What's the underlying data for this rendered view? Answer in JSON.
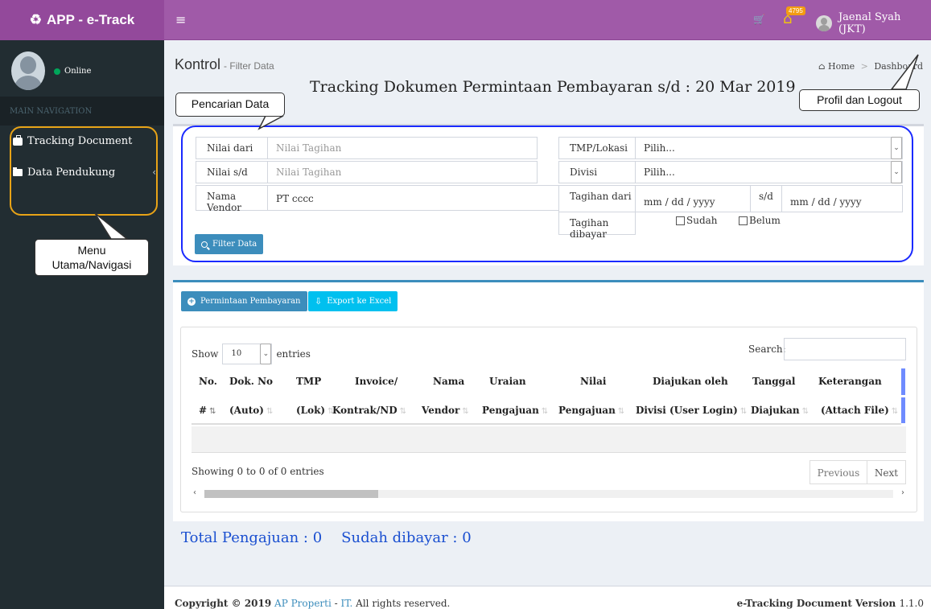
{
  "brand": {
    "title": "APP - e-Track",
    "icon": "recycle-icon"
  },
  "header": {
    "menu_icon": "≡",
    "notification_count": "4795",
    "user_name": "Jaenal Syah (JKT)"
  },
  "sidebar": {
    "status": "Online",
    "section_header": "MAIN NAVIGATION",
    "items": [
      {
        "label": "Tracking Document",
        "icon": "briefcase-icon"
      },
      {
        "label": "Data Pendukung",
        "icon": "folder-icon"
      }
    ]
  },
  "content": {
    "title": "Kontrol",
    "subtitle": "- Filter Data",
    "breadcrumb_home": "Home",
    "breadcrumb_current": "Dashboard",
    "headline": "Tracking Dokumen Permintaan Pembayaran s/d : 20 Mar 2019"
  },
  "callouts": {
    "pencarian": "Pencarian Data",
    "profil": "Profil dan Logout",
    "menu_line1": "Menu",
    "menu_line2": "Utama/Navigasi"
  },
  "filter": {
    "nilai_dari_label": "Nilai dari",
    "nilai_dari_placeholder": "Nilai Tagihan",
    "nilai_sd_label": "Nilai s/d",
    "nilai_sd_placeholder": "Nilai Tagihan",
    "vendor_label": "Nama Vendor",
    "vendor_value": "PT cccc",
    "lokasi_label": "TMP/Lokasi",
    "lokasi_value": "Pilih...",
    "divisi_label": "Divisi",
    "divisi_value": "Pilih...",
    "tagihan_dari_label": "Tagihan dari",
    "date_placeholder": "mm / dd / yyyy",
    "sd_label": "s/d",
    "dibayar_label": "Tagihan dibayar",
    "sudah_label": "Sudah",
    "belum_label": "Belum",
    "filter_button": "Filter Data"
  },
  "actions": {
    "permintaan_button": "Permintaan Pembayaran",
    "export_button": "Export ke Excel"
  },
  "table": {
    "show_label": "Show",
    "entries_value": "10",
    "entries_label": "entries",
    "search_label": "Search:",
    "header_row1": [
      "No.",
      "Dok. No",
      "TMP",
      "Invoice/",
      "Nama",
      "Uraian",
      "Nilai",
      "Diajukan oleh",
      "Tanggal",
      "Keterangan"
    ],
    "header_row2": [
      "#",
      "(Auto)",
      "(Lok)",
      "Kontrak/ND",
      "Vendor",
      "Pengajuan",
      "Pengajuan",
      "Divisi (User Login)",
      "Diajukan",
      "(Attach File)"
    ],
    "info": "Showing 0 to 0 of 0 entries",
    "previous": "Previous",
    "next": "Next"
  },
  "totals": {
    "pengajuan": "Total Pengajuan : 0",
    "dibayar": "Sudah dibayar : 0"
  },
  "footer": {
    "copyright_prefix": "Copyright © 2019",
    "company": "AP Properti",
    "dash": "-",
    "dept": "IT.",
    "rights": "All rights reserved.",
    "product": "e-Tracking Document Version",
    "version": "1.1.0"
  },
  "colors": {
    "topbar": "#a05aa8",
    "brand_bg": "#93499b",
    "sidebar": "#222d32",
    "primary_button": "#3c8dbc",
    "export_button": "#00c0ef",
    "highlight_blue": "#1a2aff",
    "highlight_orange": "#e8a317",
    "totals_text": "#1a4fd0"
  }
}
